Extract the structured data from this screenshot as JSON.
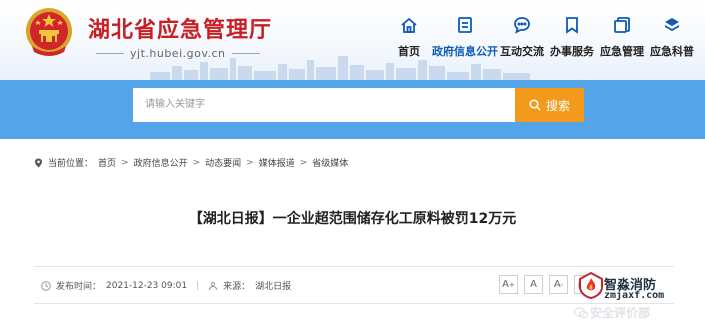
{
  "header": {
    "title": "湖北省应急管理厅",
    "url": "yjt.hubei.gov.cn",
    "nav": [
      {
        "label": "首页",
        "icon": "home-icon"
      },
      {
        "label": "政府信息公开",
        "icon": "document-icon",
        "active": true
      },
      {
        "label": "互动交流",
        "icon": "chat-icon"
      },
      {
        "label": "办事服务",
        "icon": "bookmark-icon"
      },
      {
        "label": "应急管理",
        "icon": "clipboard-icon"
      },
      {
        "label": "应急科普",
        "icon": "layers-icon"
      }
    ]
  },
  "search": {
    "placeholder": "请输入关键字",
    "button_label": "搜索"
  },
  "breadcrumb": {
    "prefix": "当前位置：",
    "items": [
      "首页",
      "政府信息公开",
      "动态要闻",
      "媒体报道",
      "省级媒体"
    ]
  },
  "article": {
    "title": "【湖北日报】一企业超范围储存化工原料被罚12万元",
    "publish_time_label": "发布时间：",
    "publish_time": "2021-12-23 09:01",
    "source_label": "来源：",
    "source": "湖北日报"
  },
  "font_controls": [
    "A+",
    "A",
    "A-"
  ],
  "watermark": {
    "line1": "智淼消防",
    "line2": "zmjaxf.com",
    "line3": "安全评价部"
  },
  "colors": {
    "brand_red": "#c71f24",
    "nav_blue": "#0d5bb5",
    "search_band": "#53a4e9",
    "search_button": "#f39a1c"
  }
}
